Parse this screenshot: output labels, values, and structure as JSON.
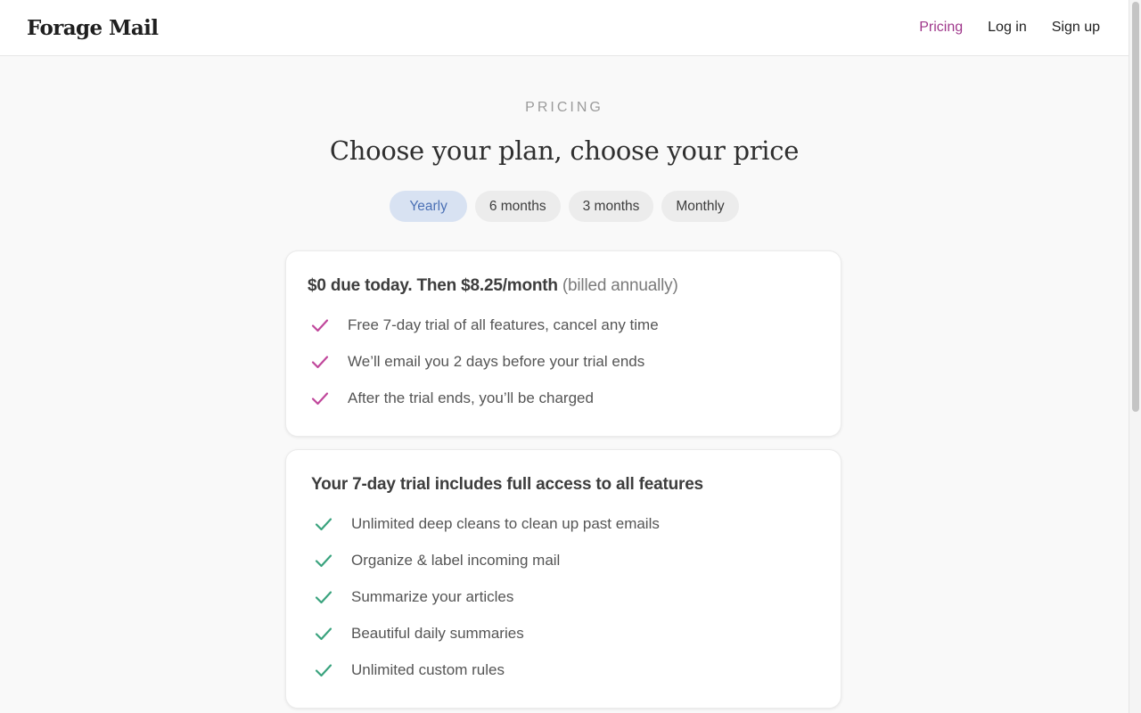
{
  "header": {
    "logo": "Forage Mail",
    "nav": [
      {
        "label": "Pricing",
        "active": true
      },
      {
        "label": "Log in",
        "active": false
      },
      {
        "label": "Sign up",
        "active": false
      }
    ]
  },
  "hero": {
    "eyebrow": "PRICING",
    "title": "Choose your plan, choose your price"
  },
  "billing_tabs": [
    {
      "label": "Yearly",
      "selected": true
    },
    {
      "label": "6 months",
      "selected": false
    },
    {
      "label": "3 months",
      "selected": false
    },
    {
      "label": "Monthly",
      "selected": false
    }
  ],
  "plan_card": {
    "price_line": "$0 due today. Then $8.25/month",
    "billing_note": "(billed annually)",
    "items": [
      "Free 7-day trial of all features, cancel any time",
      "We’ll email you 2 days before your trial ends",
      "After the trial ends, you’ll be charged"
    ],
    "check_color": "#c0479b"
  },
  "features_card": {
    "heading": "Your 7-day trial includes full access to all features",
    "items": [
      "Unlimited deep cleans to clean up past emails",
      "Organize & label incoming mail",
      "Summarize your articles",
      "Beautiful daily summaries",
      "Unlimited custom rules"
    ],
    "check_color": "#3aa37e"
  },
  "colors": {
    "accent_nav": "#a0398c",
    "tab_selected_bg": "#d8e2f2",
    "tab_selected_text": "#4b70b5"
  }
}
